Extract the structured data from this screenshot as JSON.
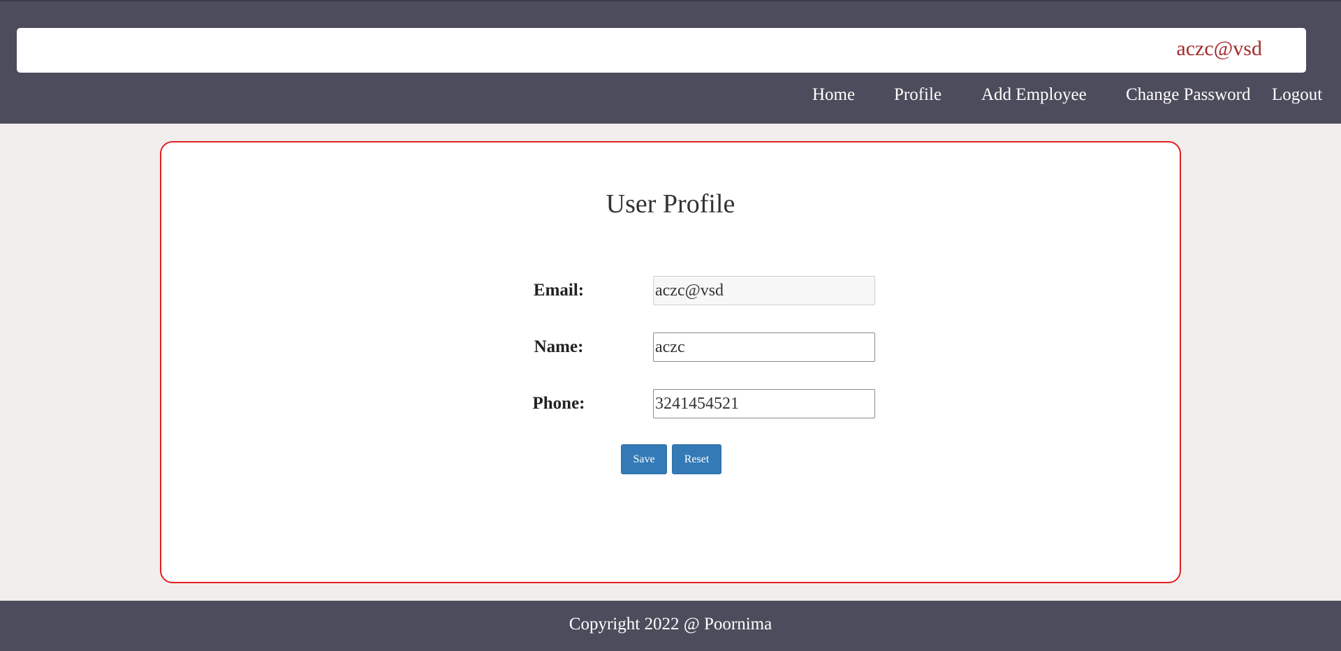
{
  "header": {
    "user_email": "aczc@vsd",
    "nav": [
      "Home",
      "Profile",
      "Add Employee",
      "Change Password",
      "Logout"
    ]
  },
  "profile": {
    "title": "User Profile",
    "email_label": "Email:",
    "email_value": "aczc@vsd",
    "name_label": "Name:",
    "name_value": "aczc",
    "phone_label": "Phone:",
    "phone_value": "3241454521",
    "save_label": "Save",
    "reset_label": "Reset"
  },
  "footer": {
    "copyright": "Copyright 2022 @ Poornima"
  },
  "colors": {
    "header_bg": "#4c4c5c",
    "page_bg": "#f3eeee",
    "card_border": "#e0201f",
    "user_email": "#a52a2a",
    "button_bg": "#337ab7"
  }
}
